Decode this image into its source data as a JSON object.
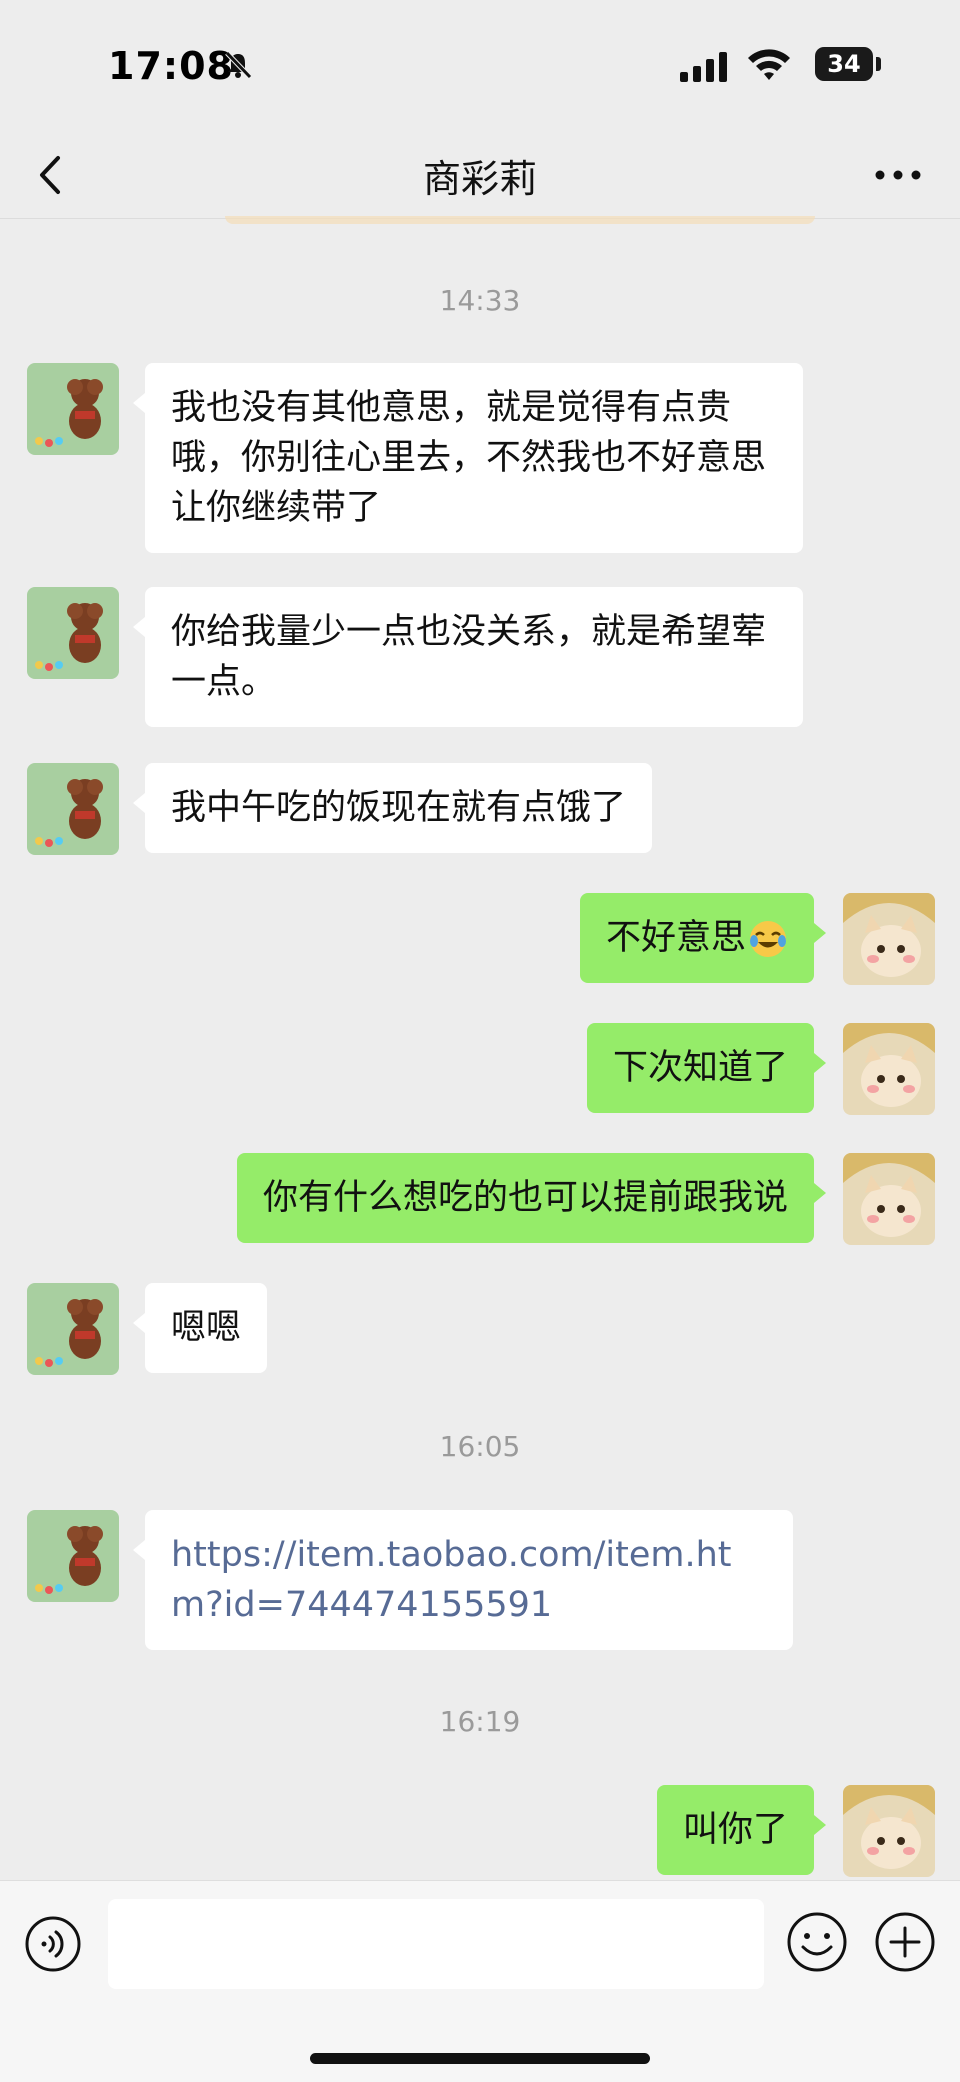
{
  "status_bar": {
    "time": "17:08",
    "battery": "34"
  },
  "header": {
    "title": "商彩莉"
  },
  "timestamps": [
    "14:33",
    "16:05",
    "16:19"
  ],
  "messages": [
    {
      "sender": "them",
      "text": "我也没有其他意思，就是觉得有点贵哦，你别往心里去，不然我也不好意思让你继续带了"
    },
    {
      "sender": "them",
      "text": "你给我量少一点也没关系，就是希望荤一点。"
    },
    {
      "sender": "them",
      "text": "我中午吃的饭现在就有点饿了"
    },
    {
      "sender": "me",
      "text": "不好意思",
      "emoji": "tears-of-joy-emoji"
    },
    {
      "sender": "me",
      "text": "下次知道了"
    },
    {
      "sender": "me",
      "text": "你有什么想吃的也可以提前跟我说"
    },
    {
      "sender": "them",
      "text": "嗯嗯"
    },
    {
      "sender": "them",
      "text": "https://item.taobao.com/item.htm?id=744474155591",
      "is_link": true
    },
    {
      "sender": "me",
      "text": "叫你了"
    }
  ],
  "input": {
    "placeholder": ""
  },
  "colors": {
    "background": "#ededed",
    "bubble_in": "#ffffff",
    "bubble_out": "#95ec69",
    "link": "#576b95"
  }
}
